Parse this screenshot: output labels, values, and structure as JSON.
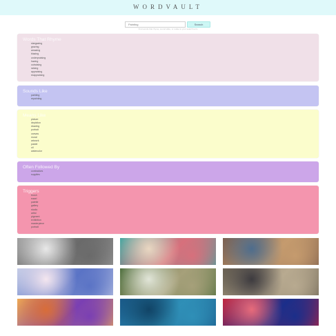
{
  "header": {
    "logo_text": "WORDVAULT"
  },
  "search": {
    "placeholder": "Painting",
    "button_label": "Search",
    "hint": "Find words that rhyme, sound alike, or relate to your search term"
  },
  "cards": [
    {
      "title": "Words That Rhyme",
      "color": "#f0e0e8",
      "items": [
        "stargazing",
        "grazing",
        "amazing",
        "blazing",
        "underpraising",
        "hazing",
        "outraising",
        "raising",
        "appraising",
        "reappraising"
      ]
    },
    {
      "title": "Sounds Like",
      "color": "#c4c4f2",
      "items": [
        "painting",
        "repainting"
      ]
    },
    {
      "title": "Means Like",
      "color": "#fbfdcc",
      "items": [
        "picture",
        "depiction",
        "drawing",
        "portrait",
        "canvas",
        "mural",
        "artwork",
        "pastel",
        "oil",
        "watercolor"
      ]
    },
    {
      "title": "Often Followed By",
      "color": "#cca6e9",
      "items": [
        "contractors",
        "supplies"
      ]
    },
    {
      "title": "Triggers",
      "color": "#f495ae",
      "items": [
        "brush",
        "easel",
        "palette",
        "gallery",
        "studio",
        "artist",
        "pigment",
        "exhibition",
        "masterpiece",
        "portrait"
      ]
    }
  ],
  "gallery": [
    {
      "alt": "studio-wall-photo",
      "colors": [
        "#9c9c9c",
        "#6a6a6a",
        "#e8e8e8"
      ]
    },
    {
      "alt": "abstract-flowers-photo",
      "colors": [
        "#3fa5a0",
        "#d7707c",
        "#e9d7c2"
      ]
    },
    {
      "alt": "paint-palette-photo",
      "colors": [
        "#7d5e4c",
        "#c59b6e",
        "#4e6d8d"
      ]
    },
    {
      "alt": "watercolor-paper-photo",
      "colors": [
        "#c3cbe6",
        "#5a73c5",
        "#f4e6ef"
      ]
    },
    {
      "alt": "garden-painter-photo",
      "colors": [
        "#486a37",
        "#a6a07a",
        "#e1e5d8"
      ]
    },
    {
      "alt": "street-artist-photo",
      "colors": [
        "#6b6253",
        "#b8aa90",
        "#3d3b3f"
      ]
    },
    {
      "alt": "purple-brush-stroke-photo",
      "colors": [
        "#f0ad55",
        "#7a3fb3",
        "#d86d39"
      ]
    },
    {
      "alt": "paint-cans-photo",
      "colors": [
        "#1a5a8a",
        "#2f8fb7",
        "#114466"
      ]
    },
    {
      "alt": "red-abstract-canvas-photo",
      "colors": [
        "#c0223c",
        "#1b2e8a",
        "#e76b7b"
      ]
    }
  ]
}
